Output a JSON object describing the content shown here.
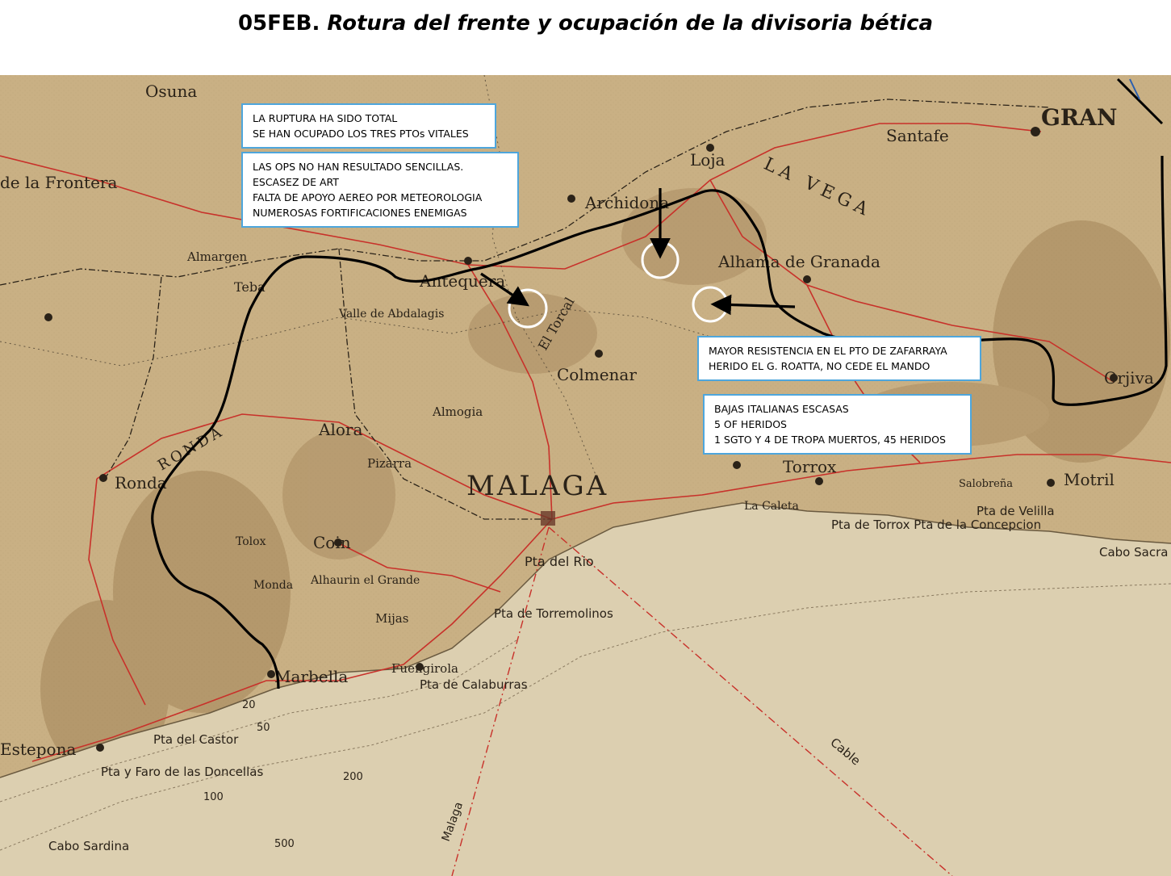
{
  "title": {
    "prefix": "05FEB.",
    "text": "Rotura del frente y ocupación de la divisoria bética"
  },
  "notes": [
    {
      "id": "ruptura",
      "lines": [
        "LA RUPTURA HA SIDO TOTAL",
        "SE HAN OCUPADO LOS TRES PTOs VITALES"
      ]
    },
    {
      "id": "ops",
      "lines": [
        "LAS OPS NO HAN RESULTADO SENCILLAS.",
        "ESCASEZ DE ART",
        "FALTA DE APOYO AEREO POR METEOROLOGIA",
        "NUMEROSAS FORTIFICACIONES ENEMIGAS"
      ]
    },
    {
      "id": "zafarraya",
      "lines": [
        "MAYOR RESISTENCIA EN EL PTO DE ZAFARRAYA",
        "HERIDO EL G. ROATTA, NO CEDE EL MANDO"
      ]
    },
    {
      "id": "bajas",
      "lines": [
        "BAJAS ITALIANAS ESCASAS",
        "5 OF HERIDOS",
        "1 SGTO Y 4 DE TROPA MUERTOS, 45 HERIDOS"
      ]
    }
  ],
  "places": {
    "osuna": "Osuna",
    "frontera": "de la Frontera",
    "teba": "Teba",
    "antequera": "Antequera",
    "archidona": "Archidona",
    "loja": "Loja",
    "alhama": "Alhama de Granada",
    "santafe": "Santafe",
    "granada": "GRAN",
    "vega": "LA VEGA",
    "ronda": "Ronda",
    "alora": "Alora",
    "colmenar": "Colmenar",
    "malaga": "MALAGA",
    "coin": "Coin",
    "torrox": "Torrox",
    "motril": "Motril",
    "orjiva": "Orjiva",
    "marbella": "Marbella",
    "estepona": "Estepona",
    "fuengirola": "Fuengirola",
    "mijas": "Mijas",
    "pizarra": "Pizarra",
    "almogia": "Almogia",
    "campillos": "Almargen",
    "caleta": "La Caleta",
    "ptarío": "Pta del Rio",
    "torremolinos": "Pta de Torremolinos",
    "calaburras": "Pta de Calaburras",
    "castor": "Pta del Castor",
    "doncellas": "Pta y Faro de las Doncellas",
    "sardina": "Cabo Sardina",
    "cable": "Cable",
    "malaga_cable": "Malaga",
    "velilla": "Pta de Velilla",
    "concepcion": "Pta de Torrox Pta de la Concepcion",
    "cabo_sacratif": "Cabo Sacra",
    "abdalagis": "Valle de Abdalagis",
    "torcal": "El Torcal",
    "ronda_sierra": "RONDA",
    "tolox": "Tolox",
    "monda": "Monda",
    "alhaurin": "Alhaurin el Grande",
    "salobrena": "Salobreña"
  },
  "depths": {
    "d20": "20",
    "d50": "50",
    "d100": "100",
    "d200": "200",
    "d500": "500"
  },
  "colors": {
    "land": "#c9b084",
    "sea": "#dccfb0",
    "road": "#c8312a",
    "front": "#000000",
    "note_border": "#4ea6dc"
  }
}
